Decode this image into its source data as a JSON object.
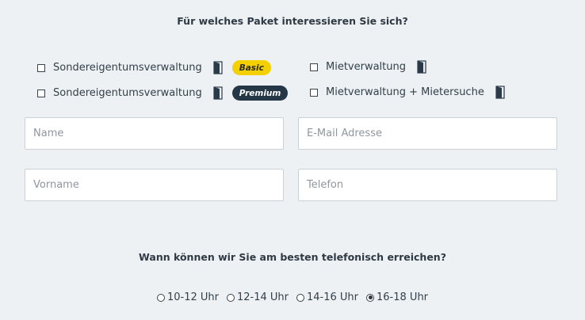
{
  "package_question": "Für welches Paket interessieren Sie sich?",
  "packages": [
    {
      "label": "Sondereigentumsverwaltung",
      "badge": "Basic",
      "checked": false
    },
    {
      "label": "Sondereigentumsverwaltung",
      "badge": "Premium",
      "checked": false
    },
    {
      "label": "Mietverwaltung",
      "checked": false
    },
    {
      "label": "Mietverwaltung + Mietersuche",
      "checked": false
    }
  ],
  "fields": {
    "name": {
      "placeholder": "Name",
      "value": ""
    },
    "email": {
      "placeholder": "E-Mail Adresse",
      "value": ""
    },
    "firstname": {
      "placeholder": "Vorname",
      "value": ""
    },
    "phone": {
      "placeholder": "Telefon",
      "value": ""
    }
  },
  "contact_question": "Wann können wir Sie am besten telefonisch erreichen?",
  "time_slots": [
    {
      "label": "10-12 Uhr",
      "selected": false
    },
    {
      "label": "12-14 Uhr",
      "selected": false
    },
    {
      "label": "14-16 Uhr",
      "selected": false
    },
    {
      "label": "16-18 Uhr",
      "selected": true
    }
  ],
  "colors": {
    "background": "#edf1f4",
    "basic_badge": "#f5d000",
    "premium_badge": "#243746",
    "door_icon": "#2a3a4a"
  }
}
